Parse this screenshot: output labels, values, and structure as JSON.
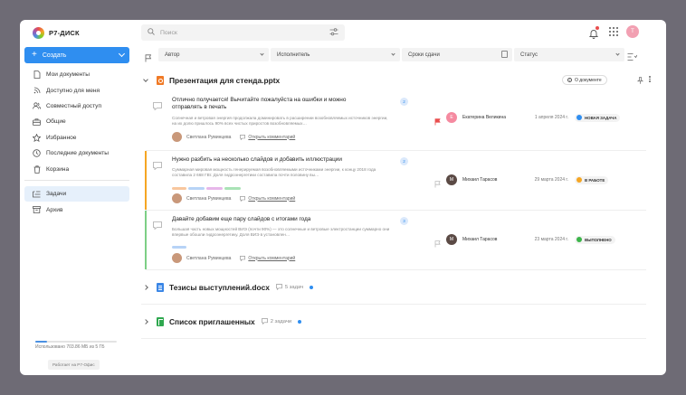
{
  "app": {
    "logo_text": "Р7-ДИСК",
    "user_initial": "Т"
  },
  "sidebar": {
    "create_label": "Создать",
    "items": [
      {
        "label": "Мои документы",
        "icon": "document-icon",
        "name": "my-documents"
      },
      {
        "label": "Доступно для меня",
        "icon": "rss-icon",
        "name": "shared-with-me"
      },
      {
        "label": "Совместный доступ",
        "icon": "users-icon",
        "name": "shared-access"
      },
      {
        "label": "Общие",
        "icon": "briefcase-icon",
        "name": "common"
      },
      {
        "label": "Избранное",
        "icon": "star-icon",
        "name": "favorites"
      },
      {
        "label": "Последние документы",
        "icon": "clock-icon",
        "name": "recent"
      },
      {
        "label": "Корзина",
        "icon": "trash-icon",
        "name": "trash"
      }
    ],
    "items2": [
      {
        "label": "Задачи",
        "icon": "tasks-icon",
        "name": "tasks",
        "active": true
      },
      {
        "label": "Архив",
        "icon": "archive-icon",
        "name": "archive"
      }
    ],
    "storage": {
      "text": "Использовано 703.86 МБ из 5 ГБ",
      "fraction": 0.14
    },
    "works_label": "Работает на Р7-Офис"
  },
  "search": {
    "placeholder": "Поиск"
  },
  "filters": {
    "author": "Автор",
    "assignee": "Исполнитель",
    "deadline": "Сроки сдачи",
    "status": "Статус"
  },
  "groups": [
    {
      "title": "Презентация для стенда.pptx",
      "about_label": "О документе",
      "tasks": [
        {
          "title": "Отлично получается! Вычитайте пожалуйста на ошибки и можно отправлять в печать",
          "count": "2",
          "desc": "Солнечная и ветровая энергия продолжала доминировать в расширении возобновляемых источников энергии, на их долю пришлось 90% всех чистых приростов возобновляемых…",
          "author": "Светлана Руминцева",
          "comment_link": "Открыть комментарий",
          "assignee": "Екатерина Великина",
          "assignee_initial": "Е",
          "assignee_color": "#f58aa0",
          "flag_color": "#e94e4e",
          "date": "1 апреля 2024 г.",
          "status": "НОВАЯ ЗАДАЧА",
          "status_color": "#2f8ef0",
          "bar_color": "",
          "tags": []
        },
        {
          "title": "Нужно разбить на несколько слайдов и добавить иллюстрации",
          "count": "2",
          "desc": "Суммарная мировая мощность генерируемая возобновляемыми источниками энергии, к концу 2018 года составила 2 668 ГВт. Доля гидроэнергетики составила почти половину вы…",
          "author": "Светлана Руминцева",
          "comment_link": "Открыть комментарий",
          "assignee": "Михаил Тарасов",
          "assignee_initial": "М",
          "assignee_color": "#5b4a45",
          "flag_color": "#bbbbbb",
          "date": "29 марта 2024 г.",
          "status": "В РАБОТЕ",
          "status_color": "#f5a623",
          "bar_color": "#f5a623",
          "tags": [
            "#f8c79e",
            "#b7d3f6",
            "#e7b7ea",
            "#a9e3b6"
          ]
        },
        {
          "title": "Давайте добавим еще пару слайдов с итогами года",
          "count": "3",
          "desc": "Большая часть новых мощностей ВИЭ (почти 90%) — это солнечные и ветровые электростанции суммарно они впервые обошли гидроэнергетику. Доля ВИЭ в установлен…",
          "author": "Светлана Руминцева",
          "comment_link": "Открыть комментарий",
          "assignee": "Михаил Тарасов",
          "assignee_initial": "М",
          "assignee_color": "#5b4a45",
          "flag_color": "#bbbbbb",
          "date": "23 марта 2024 г.",
          "status": "ВЫПОЛНЕНО",
          "status_color": "#3cb54a",
          "bar_color": "#7dcf86",
          "tags": [
            "#b7d3f6"
          ]
        }
      ]
    },
    {
      "title": "Тезисы выступлений.docx",
      "task_count": "5 задач"
    },
    {
      "title": "Список приглашенных",
      "task_count": "2 задачи"
    }
  ]
}
